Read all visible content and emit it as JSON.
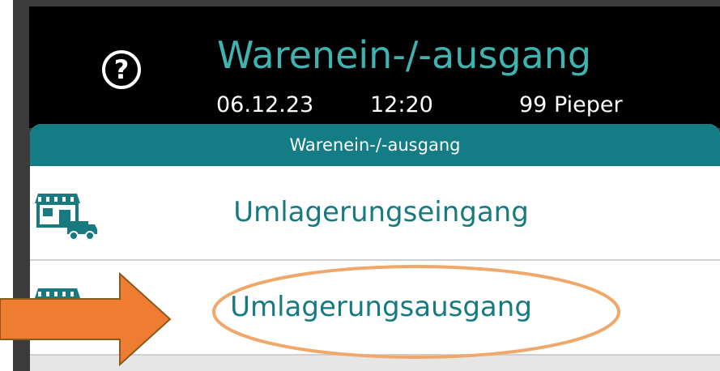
{
  "header": {
    "title": "Warenein-/-ausgang",
    "date": "06.12.23",
    "time": "12:20",
    "user": "99 Pieper",
    "help_icon": "question-circle-icon"
  },
  "panel": {
    "title": "Warenein-/-ausgang",
    "items": [
      {
        "label": "Umlagerungseingang",
        "icon": "store-truck-icon"
      },
      {
        "label": "Umlagerungsausgang",
        "icon": "store-truck-icon"
      }
    ]
  },
  "colors": {
    "accent": "#3fb3b1",
    "panel_header": "#137c85",
    "item_text": "#167a80",
    "annotation": "#f0882f"
  }
}
